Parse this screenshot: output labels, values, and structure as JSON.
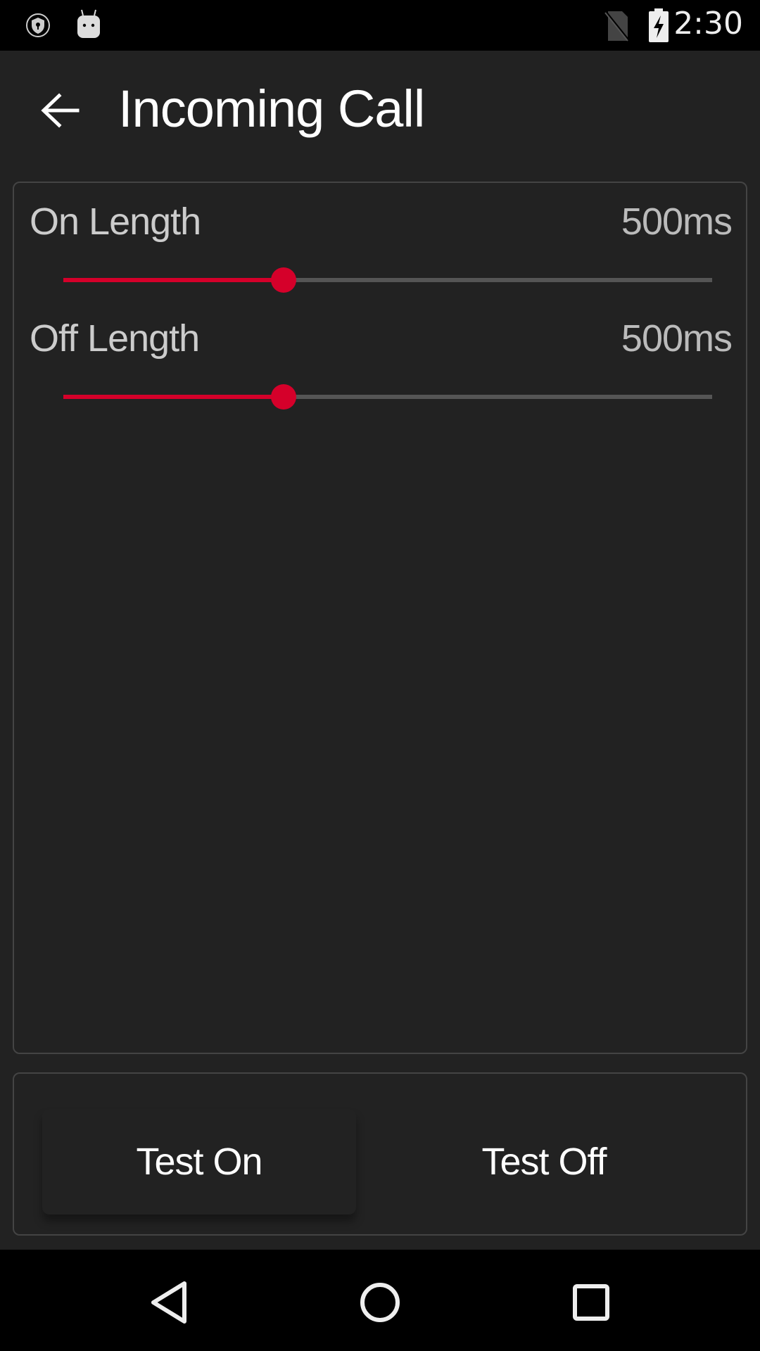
{
  "status_bar": {
    "time": "2:30",
    "left_icons": [
      "vpn-shield-icon",
      "android-icon"
    ],
    "right_icons": [
      "no-sim-icon",
      "battery-charging-icon"
    ]
  },
  "app_bar": {
    "back_icon": "arrow-left-icon",
    "title": "Incoming Call"
  },
  "settings": [
    {
      "label": "On Length",
      "value": "500ms",
      "slider_fraction": 0.34
    },
    {
      "label": "Off Length",
      "value": "500ms",
      "slider_fraction": 0.34
    }
  ],
  "buttons": {
    "test_on": "Test On",
    "test_off": "Test Off"
  },
  "colors": {
    "accent": "#d5002a",
    "track": "#555555",
    "background": "#222222"
  },
  "nav_bar": {
    "back": "nav-back-icon",
    "home": "nav-home-icon",
    "recents": "nav-recents-icon"
  }
}
